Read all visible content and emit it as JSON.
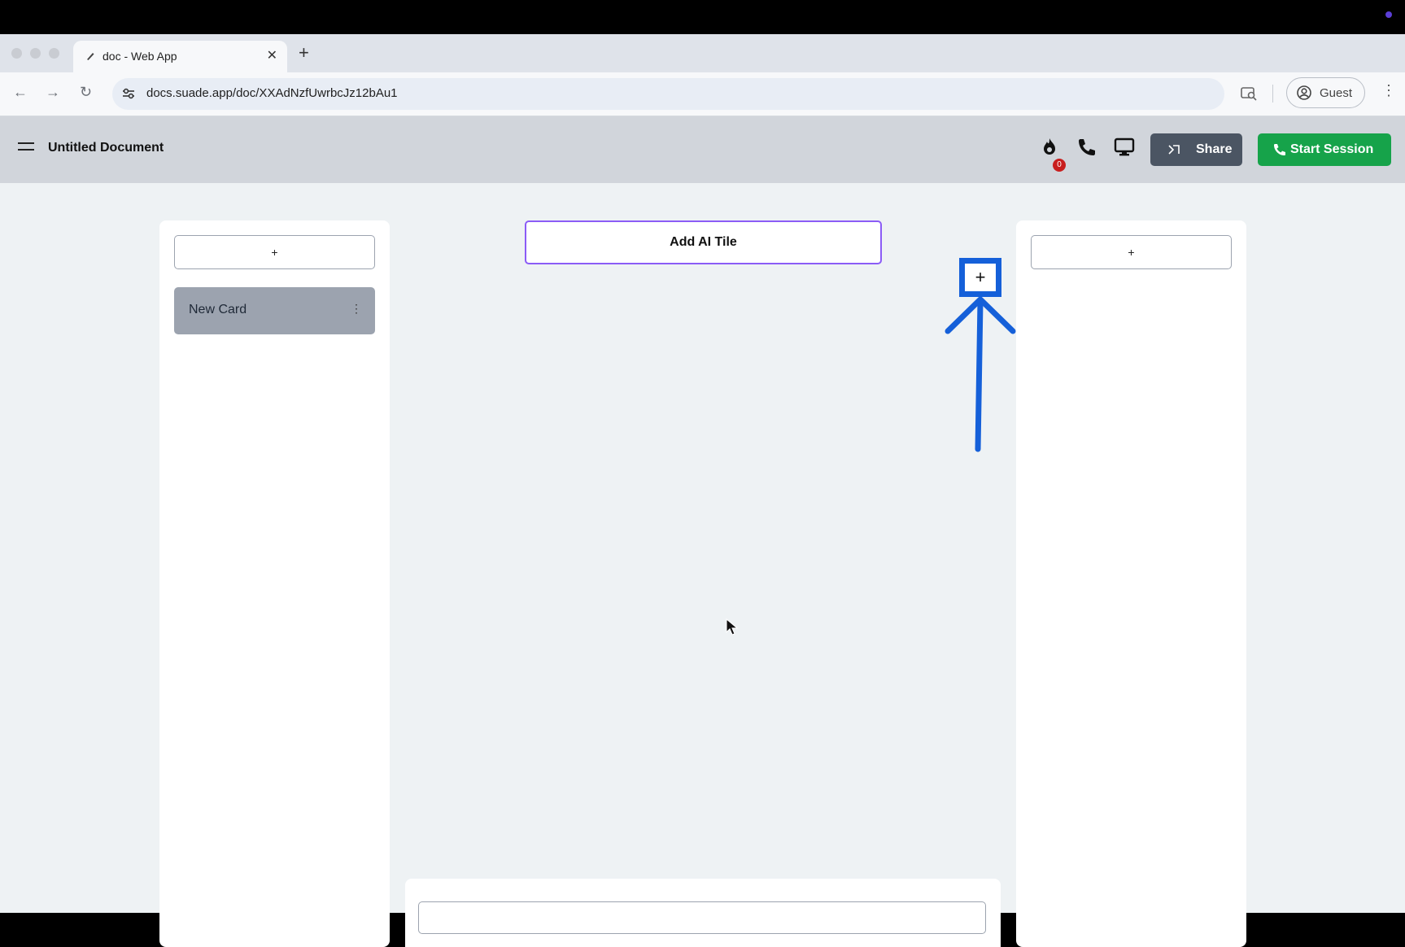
{
  "browser": {
    "tab_title": "doc - Web App",
    "url": "docs.suade.app/doc/XXAdNzfUwrbcJz12bAu1",
    "profile_label": "Guest"
  },
  "header": {
    "doc_title": "Untitled Document",
    "streak_count": "0",
    "share_label": "Share",
    "start_session_label": "Start Session"
  },
  "left_column": {
    "add_label": "+",
    "cards": [
      {
        "title": "New Card",
        "menu_icon": "⋮"
      }
    ]
  },
  "center": {
    "add_ai_tile_label": "Add AI Tile",
    "highlighted_add_label": "+"
  },
  "right_column": {
    "add_label": "+"
  },
  "colors": {
    "accent_green": "#16a34a",
    "share_gray": "#4b5563",
    "ai_tile_border": "#8b5cf6",
    "annotation_blue": "#1560d9"
  }
}
